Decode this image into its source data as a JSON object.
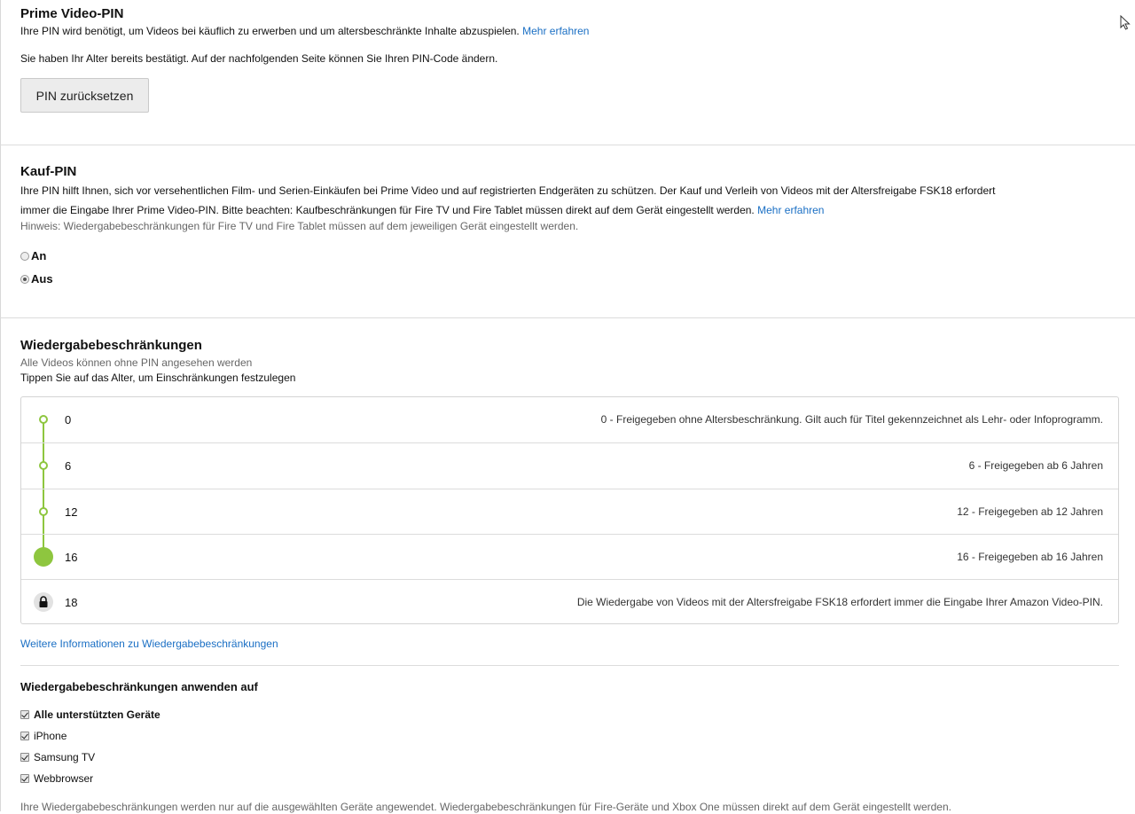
{
  "pin_section": {
    "title": "Prime Video-PIN",
    "desc": "Ihre PIN wird benötigt, um Videos bei käuflich zu erwerben und um altersbeschränkte Inhalte abzuspielen.",
    "learn_more": "Mehr erfahren",
    "confirmed_text": "Sie haben Ihr Alter bereits bestätigt. Auf der nachfolgenden Seite können Sie Ihren PIN-Code ändern.",
    "reset_button": "PIN zurücksetzen"
  },
  "purchase_pin": {
    "title": "Kauf-PIN",
    "desc_line1": "Ihre PIN hilft Ihnen, sich vor versehentlichen Film- und Serien-Einkäufen bei Prime Video und auf registrierten Endgeräten zu schützen. Der Kauf und Verleih von Videos mit der Altersfreigabe FSK18 erfordert",
    "desc_line2": "immer die Eingabe Ihrer Prime Video-PIN. Bitte beachten: Kaufbeschränkungen für Fire TV und Fire Tablet müssen direkt auf dem Gerät eingestellt werden.",
    "learn_more": "Mehr erfahren",
    "note": "Hinweis: Wiedergabebeschränkungen für Fire TV und Fire Tablet müssen auf dem jeweiligen Gerät eingestellt werden.",
    "options": [
      {
        "label": "An",
        "selected": false
      },
      {
        "label": "Aus",
        "selected": true
      }
    ]
  },
  "playback": {
    "title": "Wiedergabebeschränkungen",
    "status": "Alle Videos können ohne PIN angesehen werden",
    "instruction": "Tippen Sie auf das Alter, um Einschränkungen festzulegen",
    "selected_age": "16",
    "accent_color": "#8ec63f",
    "ratings": [
      {
        "age": "0",
        "desc": "0 - Freigegeben ohne Altersbeschränkung. Gilt auch für Titel gekennzeichnet als Lehr- oder Infoprogramm."
      },
      {
        "age": "6",
        "desc": "6 - Freigegeben ab 6 Jahren"
      },
      {
        "age": "12",
        "desc": "12 - Freigegeben ab 12 Jahren"
      },
      {
        "age": "16",
        "desc": "16 - Freigegeben ab 16 Jahren"
      },
      {
        "age": "18",
        "desc": "Die Wiedergabe von Videos mit der Altersfreigabe FSK18 erfordert immer die Eingabe Ihrer Amazon Video-PIN."
      }
    ],
    "more_info": "Weitere Informationen zu Wiedergabebeschränkungen"
  },
  "apply_to": {
    "title": "Wiedergabebeschränkungen anwenden auf",
    "devices": [
      {
        "label": "Alle unterstützten Geräte",
        "checked": true,
        "bold": true
      },
      {
        "label": "iPhone",
        "checked": true,
        "bold": false
      },
      {
        "label": "Samsung TV",
        "checked": true,
        "bold": false
      },
      {
        "label": "Webbrowser",
        "checked": true,
        "bold": false
      }
    ],
    "footnote": "Ihre Wiedergabebeschränkungen werden nur auf die ausgewählten Geräte angewendet. Wiedergabebeschränkungen für Fire-Geräte und Xbox One müssen direkt auf dem Gerät eingestellt werden."
  }
}
